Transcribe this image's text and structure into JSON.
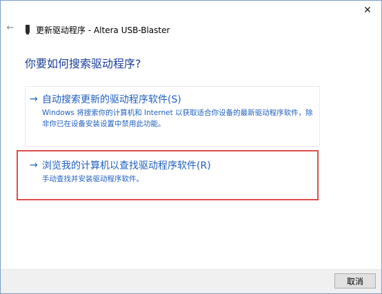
{
  "window": {
    "close_glyph": "✕",
    "back_glyph": "←",
    "title": "更新驱动程序 - Altera USB-Blaster"
  },
  "main": {
    "heading": "你要如何搜索驱动程序?",
    "options": [
      {
        "arrow": "→",
        "title": "自动搜索更新的驱动程序软件(S)",
        "description": "Windows 将搜索你的计算机和 Internet 以获取适合你设备的最新驱动程序软件，除非你已在设备安装设置中禁用此功能。"
      },
      {
        "arrow": "→",
        "title": "浏览我的计算机以查找驱动程序软件(R)",
        "description": "手动查找并安装驱动程序软件。"
      }
    ]
  },
  "footer": {
    "cancel_label": "取消"
  },
  "colors": {
    "link_blue": "#1f5fbf",
    "heading_blue": "#1a3e9a",
    "highlight_red": "#e24a4a"
  }
}
